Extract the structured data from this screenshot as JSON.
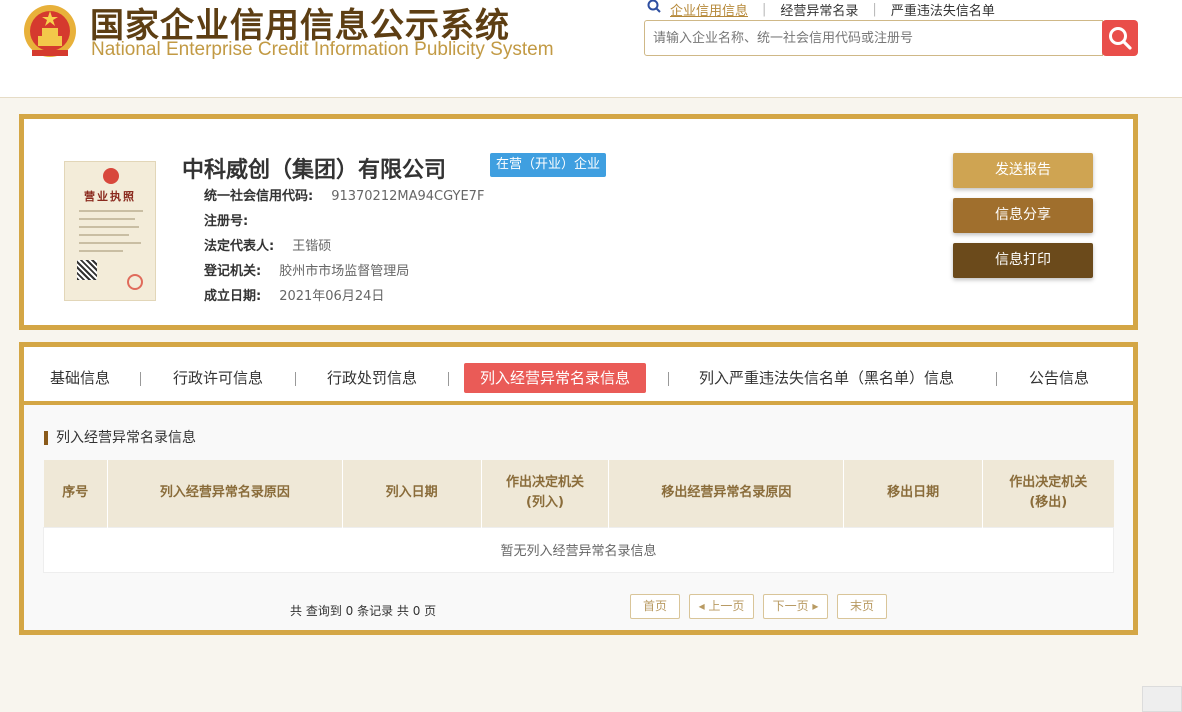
{
  "header": {
    "title_cn": "国家企业信用信息公示系统",
    "title_en": "National Enterprise Credit Information Publicity System",
    "links": [
      {
        "label": "企业信用信息"
      },
      {
        "label": "经营异常名录"
      },
      {
        "label": "严重违法失信名单"
      }
    ],
    "search": {
      "placeholder": "请输入企业名称、统一社会信用代码或注册号",
      "value": ""
    }
  },
  "company": {
    "name": "中科威创（集团）有限公司",
    "status": "在营（开业）企业",
    "license_title": "营业执照",
    "fields": [
      {
        "label": "统一社会信用代码:",
        "value": "91370212MA94CGYE7F"
      },
      {
        "label": "注册号:",
        "value": ""
      },
      {
        "label": "法定代表人:",
        "value": "王锴硕"
      },
      {
        "label": "登记机关:",
        "value": "胶州市市场监督管理局"
      },
      {
        "label": "成立日期:",
        "value": "2021年06月24日"
      }
    ],
    "actions": {
      "report": "发送报告",
      "share": "信息分享",
      "print": "信息打印"
    }
  },
  "tabs": [
    {
      "label": "基础信息"
    },
    {
      "label": "行政许可信息"
    },
    {
      "label": "行政处罚信息"
    },
    {
      "label": "列入经营异常名录信息"
    },
    {
      "label": "列入严重违法失信名单（黑名单）信息"
    },
    {
      "label": "公告信息"
    }
  ],
  "active_tab": 3,
  "section": {
    "title": "列入经营异常名录信息",
    "columns": [
      {
        "line1": "序号",
        "line2": ""
      },
      {
        "line1": "列入经营异常名录原因",
        "line2": ""
      },
      {
        "line1": "列入日期",
        "line2": ""
      },
      {
        "line1": "作出决定机关",
        "line2": "(列入)"
      },
      {
        "line1": "移出经营异常名录原因",
        "line2": ""
      },
      {
        "line1": "移出日期",
        "line2": ""
      },
      {
        "line1": "作出决定机关",
        "line2": "(移出)"
      }
    ],
    "empty_text": "暂无列入经营异常名录信息",
    "record_count": "共 查询到 0 条记录 共 0 页"
  },
  "pager": {
    "first": "首页",
    "prev": "上一页",
    "next": "下一页",
    "last": "末页"
  },
  "colors": {
    "gold": "#d4a645",
    "brown": "#5d3e13",
    "active_tab": "#ea5b57",
    "status_badge": "#3f9fe0",
    "search_button": "#e94e4a"
  }
}
